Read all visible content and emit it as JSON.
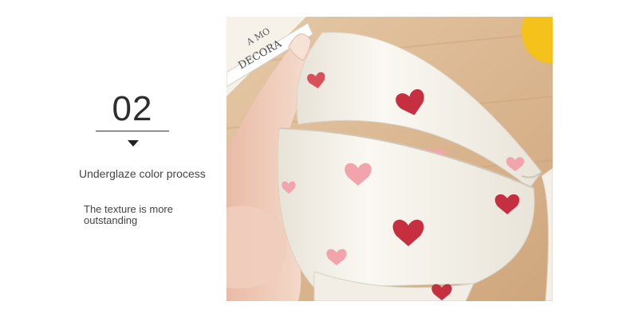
{
  "feature": {
    "number": "02",
    "title": "Underglaze color process",
    "description": "The texture is more outstanding",
    "arrow_icon": "caret-down-icon"
  },
  "photo": {
    "book_text_line1": "A MO",
    "book_text_line2": "DECORA",
    "colors": {
      "table": "#d9b48c",
      "bowl": "#f4f0e8",
      "heart_red": "#c62f3f",
      "heart_pink": "#f1a4ab",
      "skin": "#f0cdbd",
      "accent_yellow": "#f5c21b"
    }
  }
}
